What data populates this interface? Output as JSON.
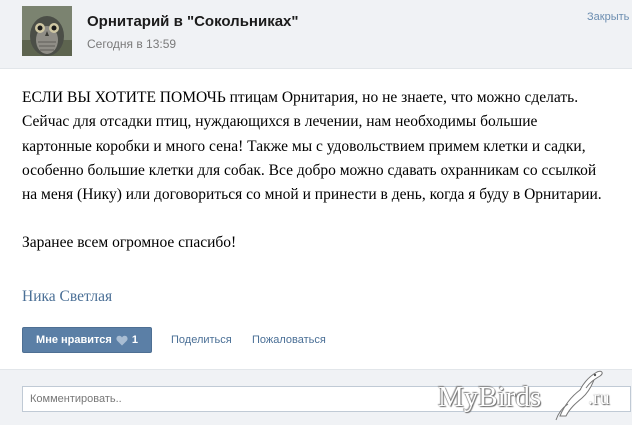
{
  "header": {
    "title": "Орнитарий в \"Сокольниках\"",
    "time": "Сегодня в 13:59",
    "close_label": "Закрыть"
  },
  "post": {
    "paragraphs": [
      "ЕСЛИ ВЫ ХОТИТЕ ПОМОЧЬ птицам Орнитария, но не знаете, что можно сделать. Сейчас для отсадки птиц, нуждающихся в лечении, нам необходимы большие картонные коробки и много сена! Также мы с удовольствием примем клетки и садки, особенно большие клетки для собак. Все добро можно сдавать охранникам со ссылкой на меня (Нику) или договориться со мной и принести в день, когда я буду в Орнитарии.",
      "Заранее всем огромное спасибо!"
    ],
    "author": "Ника Светлая"
  },
  "actions": {
    "like_label": "Мне нравится",
    "like_count": "1",
    "share_label": "Поделиться",
    "report_label": "Пожаловаться"
  },
  "comment": {
    "placeholder": "Комментировать.."
  },
  "watermark": {
    "text": "MyBirds",
    "suffix": ".ru"
  },
  "colors": {
    "link": "#4a6f96",
    "like_button": "#5b7fa6",
    "header_bg": "#f0f2f5"
  },
  "icons": {
    "avatar": "owl-photo",
    "like": "heart-icon",
    "watermark": "bird-logo"
  }
}
